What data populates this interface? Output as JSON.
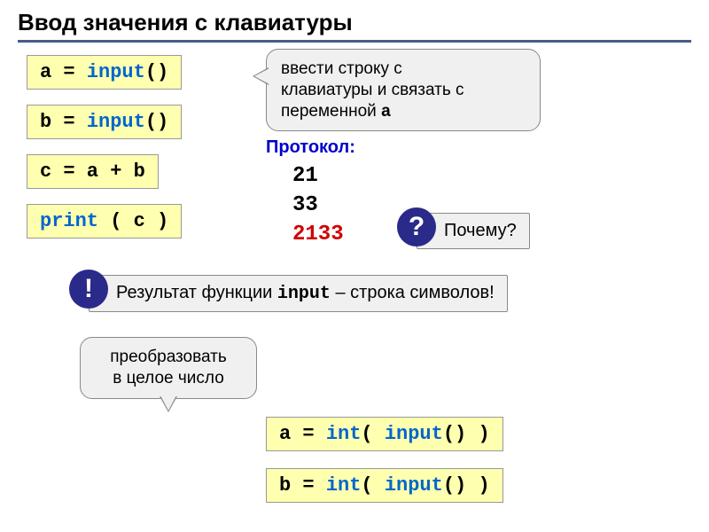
{
  "title": "Ввод значения с клавиатуры",
  "box1": {
    "var": "a = ",
    "fn": "input",
    "tail": "()"
  },
  "box2": {
    "var": "b = ",
    "fn": "input",
    "tail": "()"
  },
  "box3": {
    "text": "c = a + b"
  },
  "box4": {
    "fn": "print",
    "tail": " ( c )"
  },
  "callout1": {
    "line1": "ввести строку с",
    "line2": "клавиатуры и связать с",
    "line3": "переменной ",
    "bold": "a"
  },
  "protocol": {
    "label": "Протокол:",
    "v1": "21",
    "v2": "33",
    "v3": "2133"
  },
  "why": {
    "mark": "?",
    "text": "Почему?"
  },
  "note": {
    "mark": "!",
    "pre": "Результат функции ",
    "fn": "input",
    "post": " – строка символов!"
  },
  "convert": {
    "line1": "преобразовать",
    "line2": "в целое число"
  },
  "box5": {
    "var": "a = ",
    "fn1": "int",
    "mid": "( ",
    "fn2": "input",
    "tail": "() )"
  },
  "box6": {
    "var": "b = ",
    "fn1": "int",
    "mid": "( ",
    "fn2": "input",
    "tail": "() )"
  }
}
